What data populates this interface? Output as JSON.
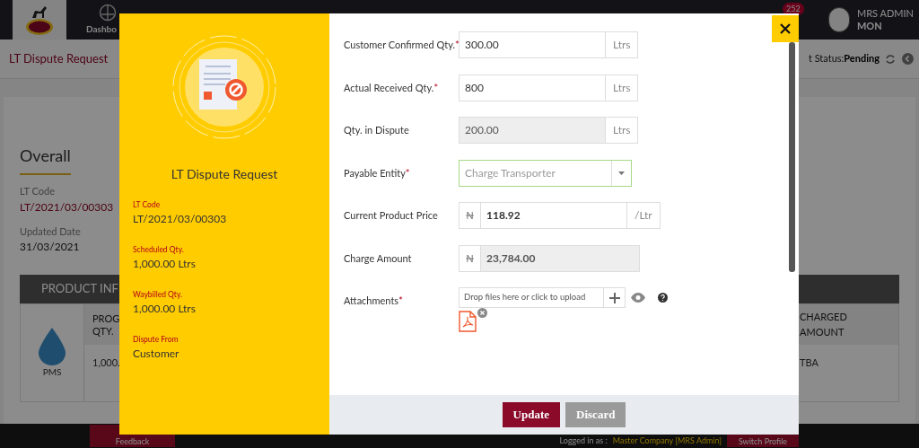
{
  "background": {
    "nav": [
      {
        "label": "Dashbo"
      }
    ],
    "breadcrumb": "LT Dispute Request",
    "status_label": "t Status:",
    "status_value": "Pending",
    "notification_count": "252",
    "user": {
      "name": "MRS ADMIN",
      "role": "MON"
    },
    "overview": {
      "title": "Overall",
      "fields": [
        {
          "label": "LT Code",
          "value": "LT/2021/03/00303",
          "kind": "link"
        },
        {
          "label": "Updated Date",
          "value": "31/03/2021",
          "kind": "plain"
        }
      ]
    },
    "product_info": {
      "title": "PRODUCT INF",
      "product": "PMS",
      "column_1": "PROG QTY.",
      "cell_1": "1,000.",
      "column_2": "CHARGED AMOUNT",
      "cell_2": "TBA"
    },
    "footer": {
      "feedback": "Feedback",
      "logged_in_label": "Logged in as :",
      "logged_in_value": "Master Company [MRS Admin]",
      "switch_profile": "Switch Profile"
    }
  },
  "modal": {
    "title": "LT Dispute Request",
    "required_mark": "*",
    "details": [
      {
        "label": "LT Code",
        "value": "LT/2021/03/00303"
      },
      {
        "label": "Scheduled Qty.",
        "value": "1,000.00 Ltrs"
      },
      {
        "label": "Waybilled Qty.",
        "value": "1,000.00 Ltrs"
      },
      {
        "label": "Dispute From",
        "value": "Customer"
      }
    ],
    "fields": [
      {
        "kind": "input",
        "label": "Customer Confirmed Qty.",
        "required": true,
        "value": "300.00",
        "suffix": "Ltrs",
        "disabled": false
      },
      {
        "kind": "input",
        "label": "Actual Received Qty.",
        "required": true,
        "value": "800",
        "suffix": "Ltrs",
        "disabled": false
      },
      {
        "kind": "input",
        "label": "Qty. in Dispute",
        "required": false,
        "value": "200.00",
        "suffix": "Ltrs",
        "disabled": true
      },
      {
        "kind": "select",
        "label": "Payable Entity",
        "required": true,
        "placeholder": "Charge Transporter"
      },
      {
        "kind": "input",
        "label": "Current Product Price",
        "required": false,
        "prefix": "₦",
        "value": "118.92",
        "suffix": "/Ltr",
        "disabled": false
      },
      {
        "kind": "input",
        "label": "Charge Amount",
        "required": false,
        "prefix": "₦",
        "value": "23,784.00",
        "disabled": true
      },
      {
        "kind": "upload",
        "label": "Attachments",
        "required": true,
        "placeholder": "Drop files here or click to upload"
      }
    ],
    "buttons": [
      {
        "label": "Update",
        "kind": "primary"
      },
      {
        "label": "Discard",
        "kind": "secondary"
      }
    ]
  }
}
